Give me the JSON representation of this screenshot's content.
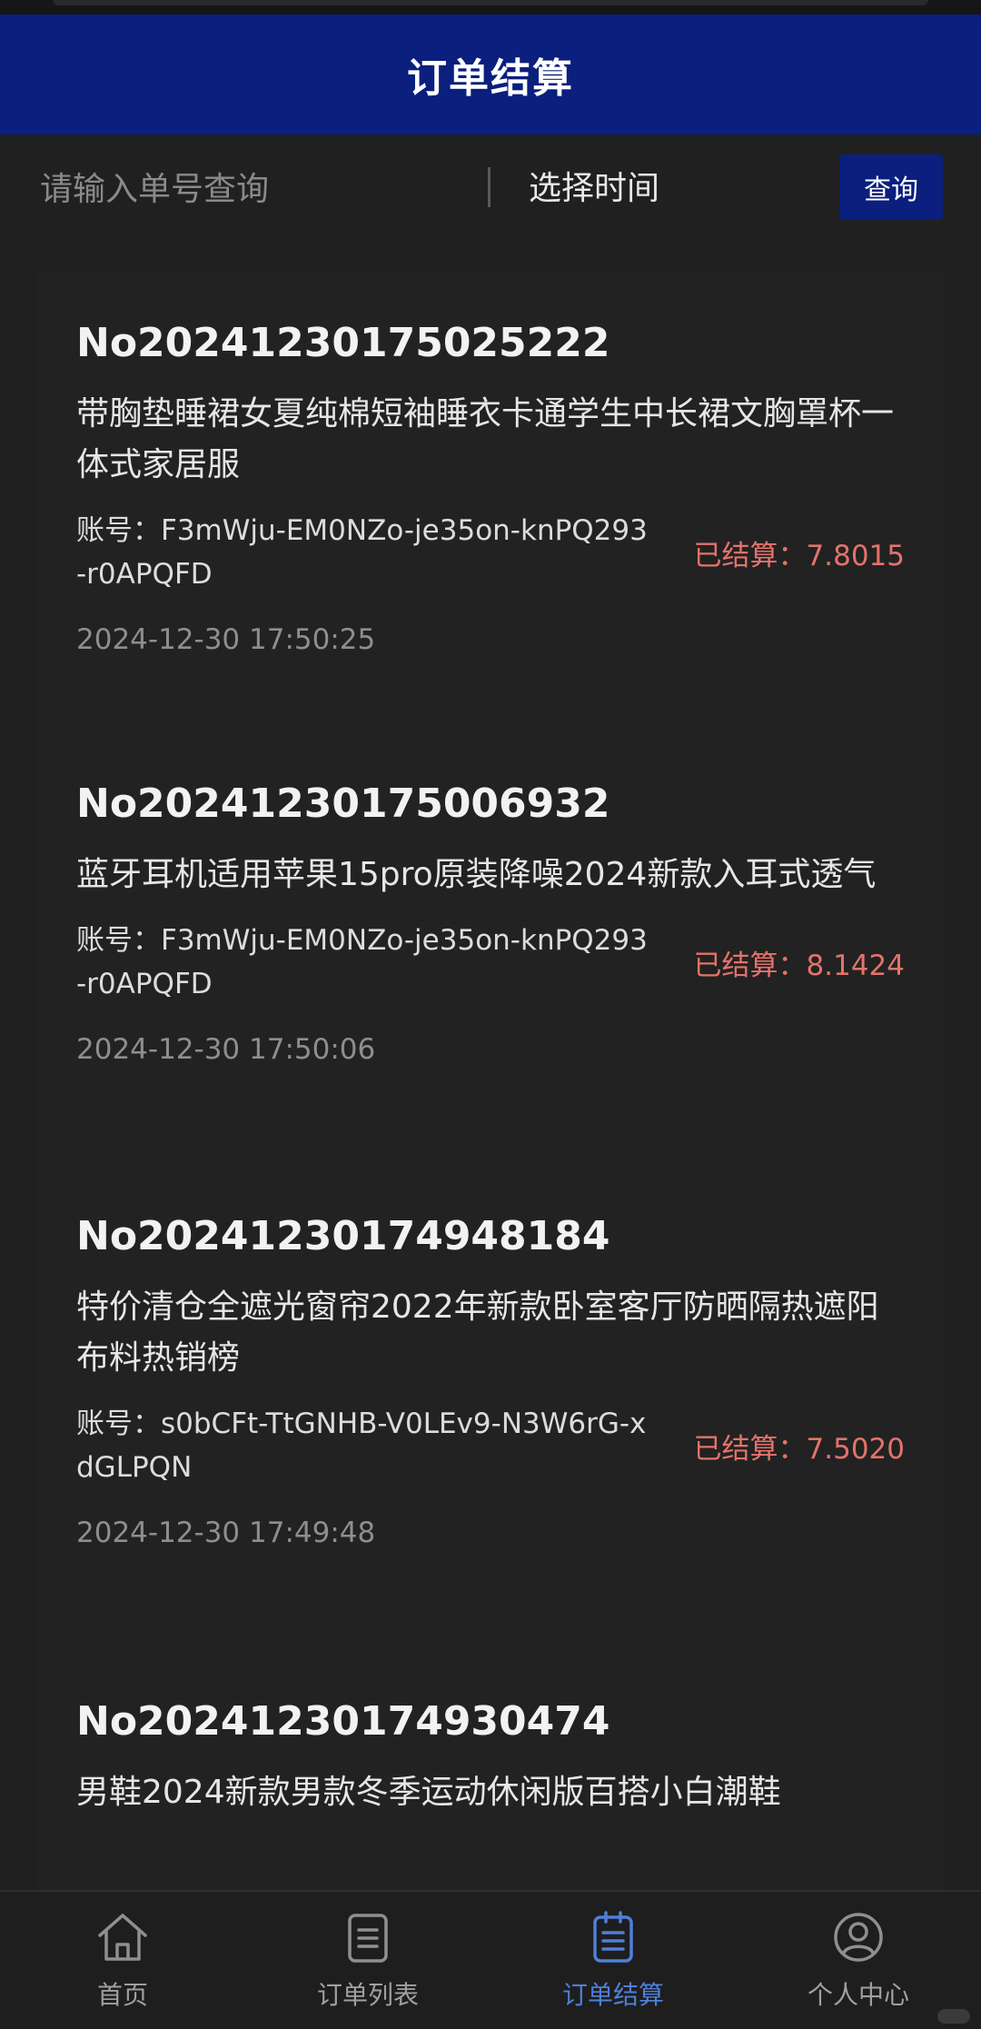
{
  "header": {
    "title": "订单结算"
  },
  "search": {
    "placeholder": "请输入单号查询",
    "value": "",
    "date_label": "选择时间",
    "button_label": "查询"
  },
  "orders": [
    {
      "order_no": "No20241230175025222",
      "title": "带胸垫睡裙女夏纯棉短袖睡衣卡通学生中长裙文胸罩杯一体式家居服",
      "account": "账号：F3mWju-EM0NZo-je35on-knPQ293-r0APQFD",
      "status": "已结算：7.8015",
      "time": "2024-12-30 17:50:25"
    },
    {
      "order_no": "No20241230175006932",
      "title": "蓝牙耳机适用苹果15pro原装降噪2024新款入耳式透气",
      "account": "账号：F3mWju-EM0NZo-je35on-knPQ293-r0APQFD",
      "status": "已结算：8.1424",
      "time": "2024-12-30 17:50:06"
    },
    {
      "order_no": "No20241230174948184",
      "title": "特价清仓全遮光窗帘2022年新款卧室客厅防晒隔热遮阳布料热销榜",
      "account": "账号：s0bCFt-TtGNHB-V0LEv9-N3W6rG-xdGLPQN",
      "status": "已结算：7.5020",
      "time": "2024-12-30 17:49:48"
    },
    {
      "order_no": "No20241230174930474",
      "title": "男鞋2024新款男款冬季运动休闲版百搭小白潮鞋",
      "account": "",
      "status": "",
      "time": ""
    }
  ],
  "nav": {
    "items": [
      {
        "label": "首页",
        "icon": "home-icon",
        "active": false
      },
      {
        "label": "订单列表",
        "icon": "order-list-icon",
        "active": false
      },
      {
        "label": "订单结算",
        "icon": "settlement-icon",
        "active": true
      },
      {
        "label": "个人中心",
        "icon": "user-icon",
        "active": false
      }
    ],
    "colors": {
      "active": "#4f7fd8",
      "inactive": "#a0a0a0"
    }
  },
  "colors": {
    "header_bg": "#0a1f7e",
    "page_bg": "#202020",
    "status_text": "#e3736b"
  }
}
